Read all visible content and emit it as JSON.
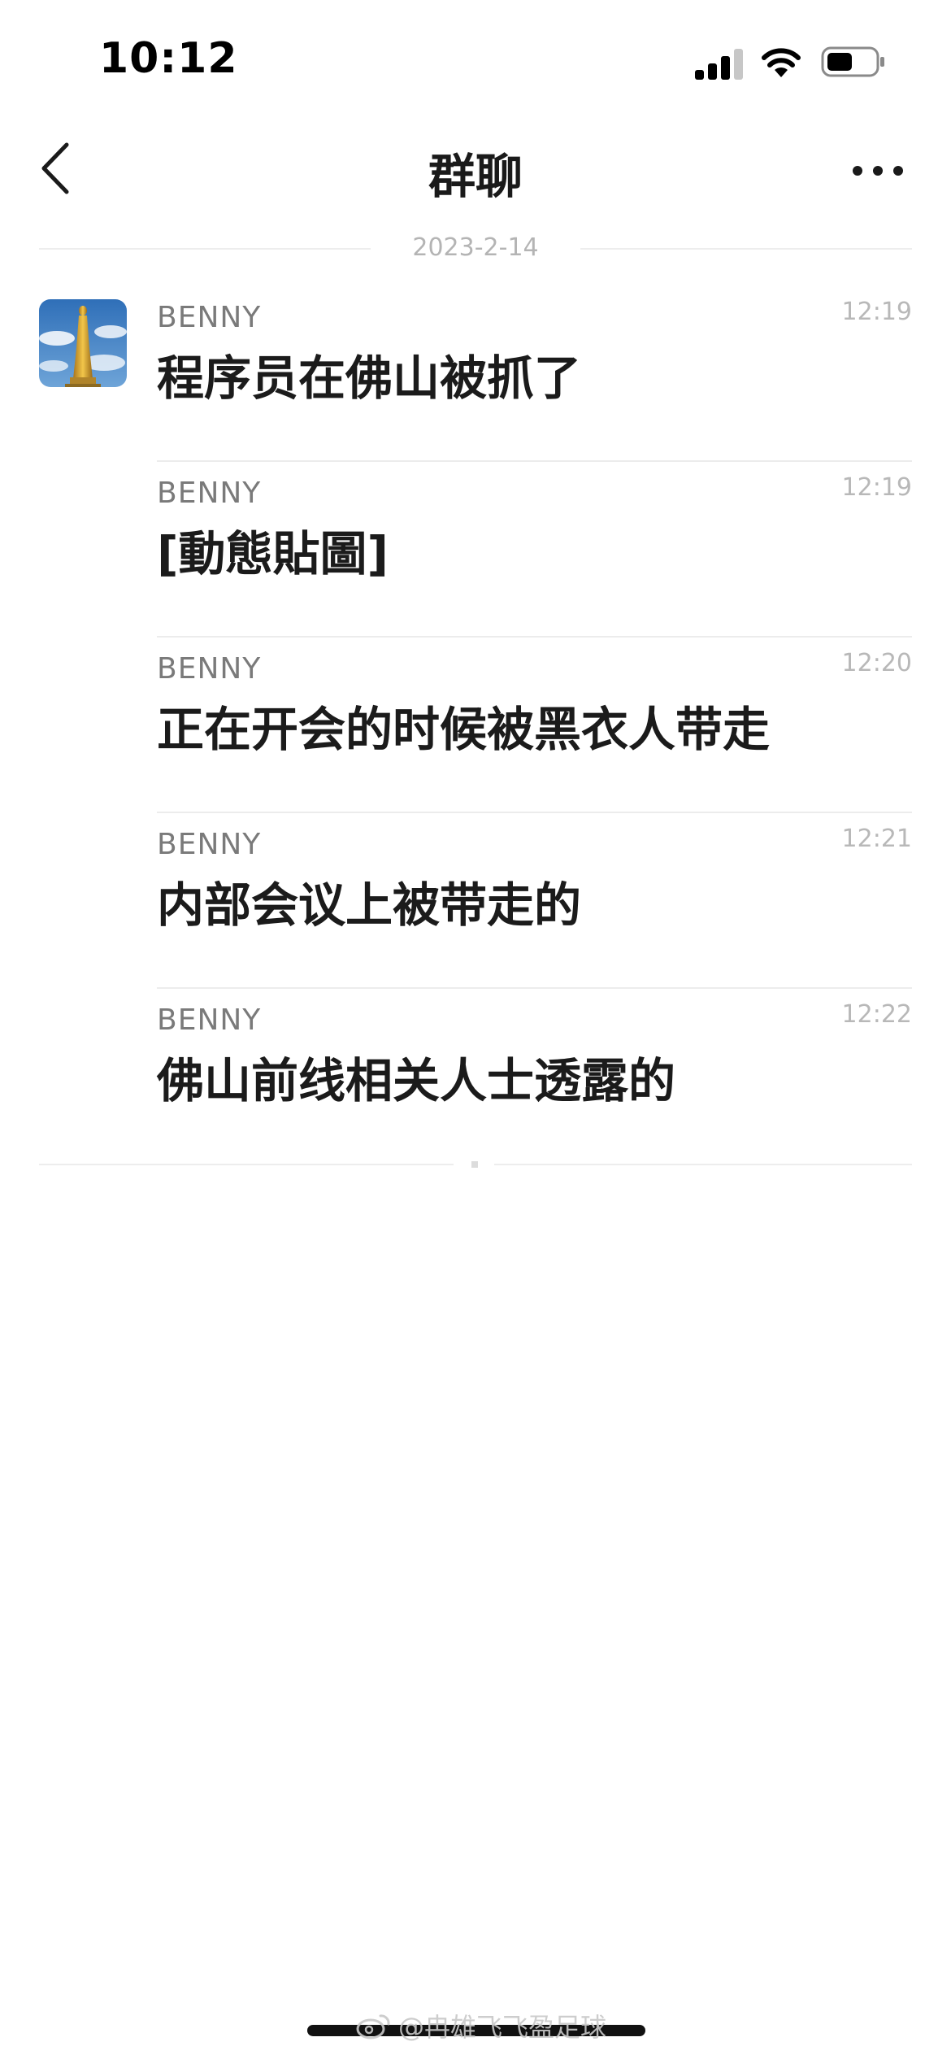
{
  "status_bar": {
    "time": "10:12",
    "icons": [
      "signal-icon",
      "wifi-icon",
      "battery-icon"
    ]
  },
  "nav": {
    "title": "群聊",
    "back_icon": "chevron-left-icon",
    "more_icon": "more-horizontal-icon"
  },
  "date_separator": "2023-2-14",
  "messages": [
    {
      "sender": "BENNY",
      "time": "12:19",
      "text": "程序员在佛山被抓了"
    },
    {
      "sender": "BENNY",
      "time": "12:19",
      "text": "[動態貼圖]"
    },
    {
      "sender": "BENNY",
      "time": "12:20",
      "text": "正在开会的时候被黑衣人带走"
    },
    {
      "sender": "BENNY",
      "time": "12:21",
      "text": "内部会议上被带走的"
    },
    {
      "sender": "BENNY",
      "time": "12:22",
      "text": "佛山前线相关人士透露的"
    }
  ],
  "watermark": "@冉雄飞飞盈足球",
  "colors": {
    "text_primary": "#1b1b1b",
    "text_secondary": "#7a7a7a",
    "text_muted": "#b8b8b8",
    "divider": "#ececec",
    "background": "#ffffff"
  }
}
